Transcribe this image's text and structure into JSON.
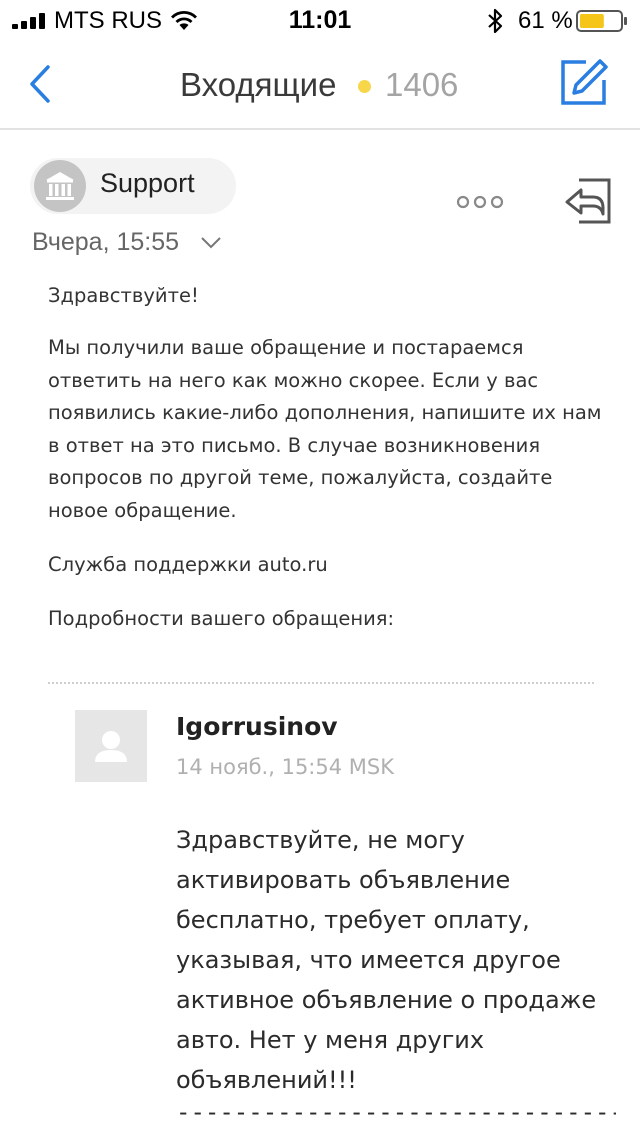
{
  "status_bar": {
    "carrier": "MTS RUS",
    "time": "11:01",
    "battery": "61 %",
    "battery_level": 0.61
  },
  "nav": {
    "title": "Входящие",
    "count": "1406",
    "back_icon": "chevron-left-icon",
    "compose_icon": "compose-icon",
    "accent_color": "#2a7de1",
    "unread_dot_color": "#f7d64a"
  },
  "mail": {
    "sender": "Support",
    "date": "Вчера, 15:55",
    "greeting": "Здравствуйте!",
    "main_text": "Мы получили ваше обращение и постараемся ответить на него как можно скорее. Если у вас появились какие-либо дополнения, напишите их нам в ответ на это письмо. В случае возникновения вопросов по другой теме, пожалуйста, создайте новое обращение.",
    "signature": "Служба поддержки auto.ru",
    "details_label": "Подробности вашего обращения:"
  },
  "quoted": {
    "author": "Igorrusinov",
    "date": "14 нояб., 15:54 MSK",
    "text": "Здравствуйте, не могу активировать объявление бесплатно, требует оплату, указывая, что имеется другое активное объявление о продаже авто. Нет у меня других объявлений!!!",
    "rule": "----------------------------------------"
  }
}
